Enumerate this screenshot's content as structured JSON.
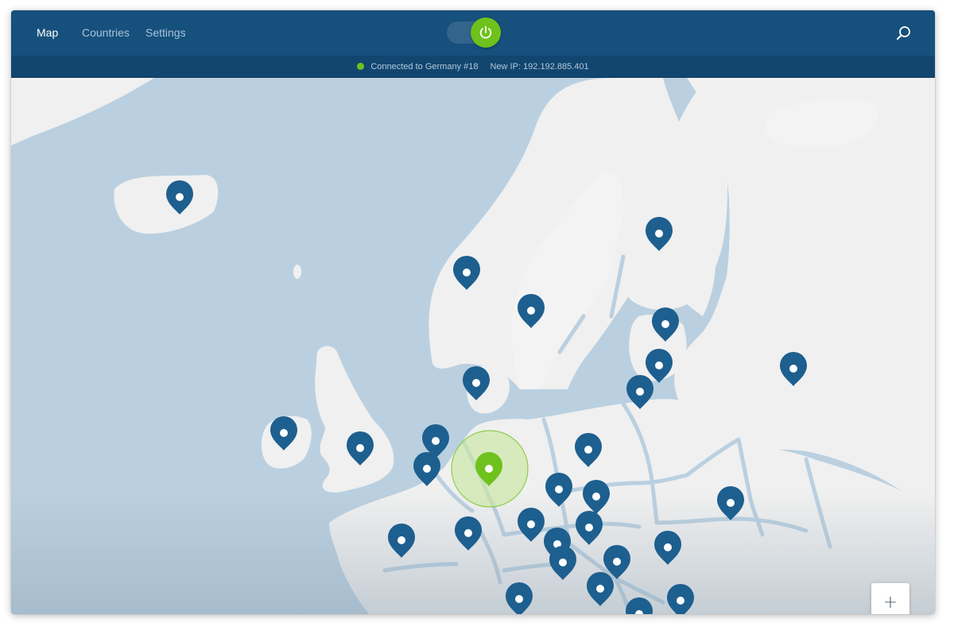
{
  "nav": {
    "items": [
      {
        "label": "Map",
        "active": true
      },
      {
        "label": "Countries",
        "active": false
      },
      {
        "label": "Settings",
        "active": false
      }
    ]
  },
  "toggle": {
    "state": "on",
    "icon": "power-icon",
    "color": "#6ec21b"
  },
  "search": {
    "icon": "search-icon"
  },
  "status": {
    "connected": "Connected to Germany #18",
    "ip": "New IP: 192.192.885.401",
    "dot_color": "#6ec21b"
  },
  "map": {
    "pin_color": "#1d5f8f",
    "active_pin_color": "#6ec21b",
    "active_server": "Germany #18"
  },
  "zoom": {
    "in_label": "+",
    "out_label": "−"
  },
  "colors": {
    "topbar": "#16507c",
    "statusbar": "#114670",
    "sea": "#bad0e0",
    "land": "#f0f0f0"
  }
}
